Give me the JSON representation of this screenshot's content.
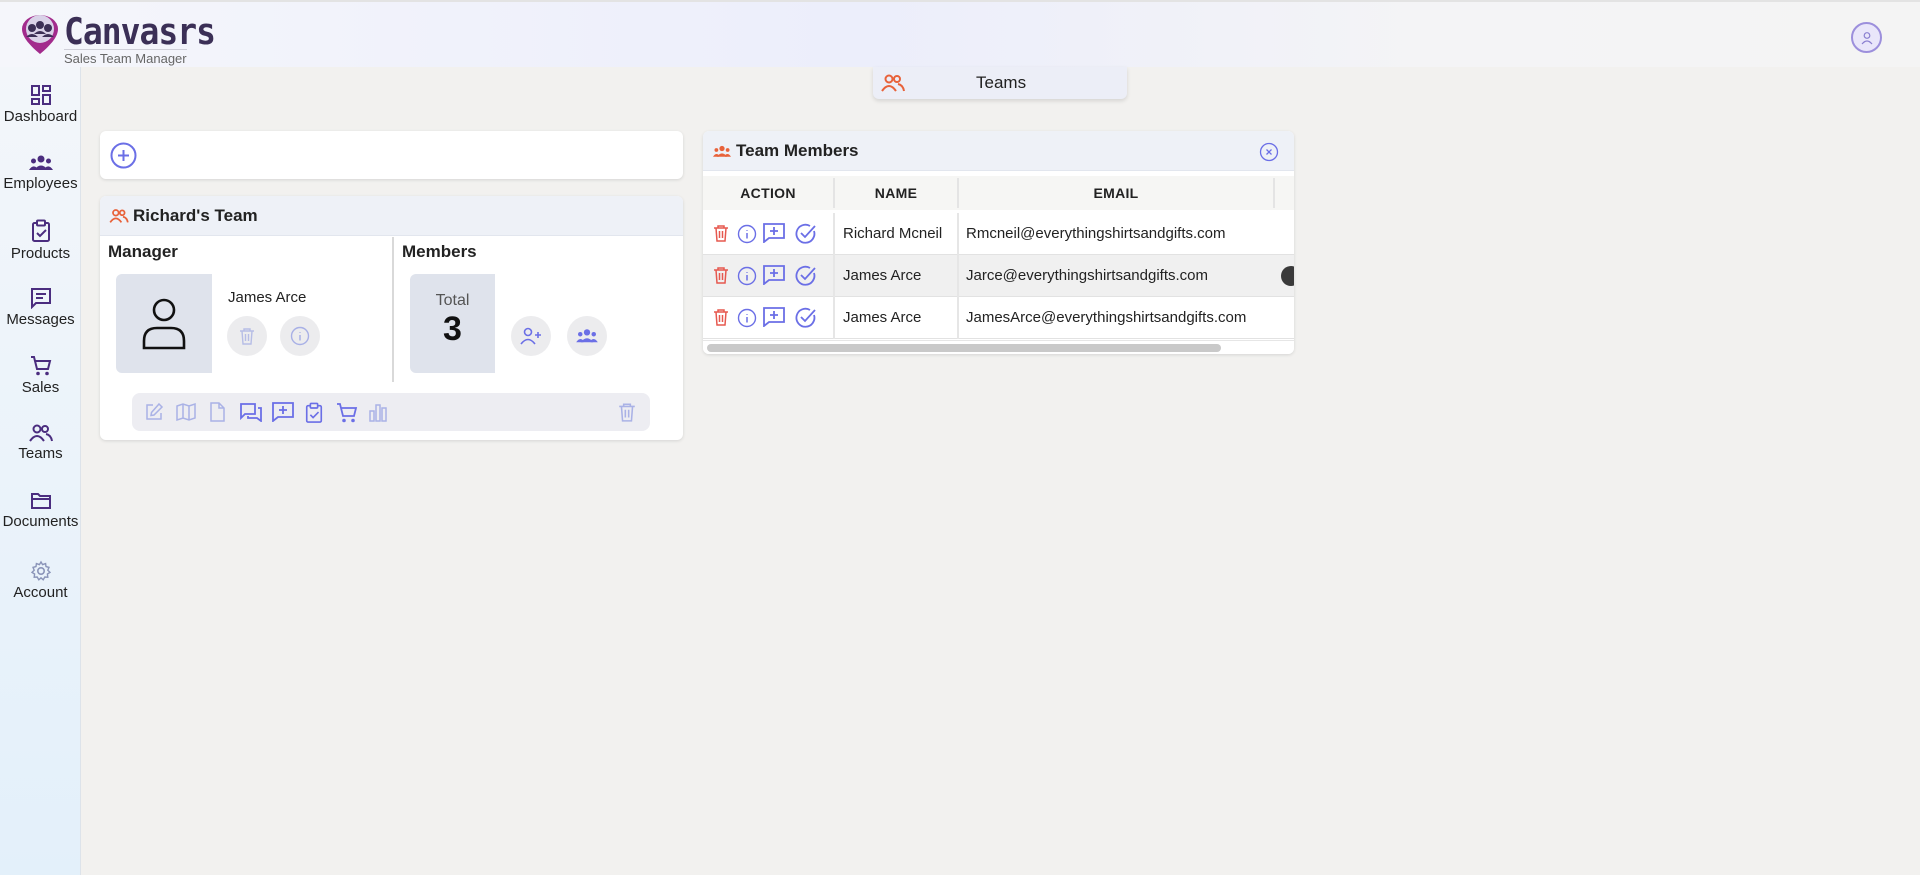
{
  "app": {
    "brand": "Canvasrs",
    "subtitle": "Sales Team Manager"
  },
  "colors": {
    "accent": "#6b6fe6",
    "nav_icon": "#4b2d7f",
    "orange_icon": "#e8623a",
    "delete_red": "#e6584f",
    "panel_header": "#eef1f7"
  },
  "sidebar": {
    "items": [
      {
        "label": "Dashboard",
        "icon": "dashboard-icon"
      },
      {
        "label": "Employees",
        "icon": "employees-icon"
      },
      {
        "label": "Products",
        "icon": "clipboard-check-icon"
      },
      {
        "label": "Messages",
        "icon": "message-icon"
      },
      {
        "label": "Sales",
        "icon": "cart-icon"
      },
      {
        "label": "Teams",
        "icon": "teams-icon"
      },
      {
        "label": "Documents",
        "icon": "folder-icon"
      },
      {
        "label": "Account",
        "icon": "gear-icon"
      }
    ]
  },
  "page_tab": {
    "label": "Teams",
    "icon": "teams-icon"
  },
  "team": {
    "title": "Richard's Team",
    "manager_title": "Manager",
    "manager_name": "James Arce",
    "members_title": "Members",
    "total_label": "Total",
    "total_value": "3"
  },
  "members_panel": {
    "title": "Team Members",
    "columns": [
      "ACTION",
      "NAME",
      "EMAIL"
    ],
    "rows": [
      {
        "name": "Richard Mcneil",
        "email": "Rmcneil@everythingshirtsandgifts.com"
      },
      {
        "name": "James Arce",
        "email": "Jarce@everythingshirtsandgifts.com"
      },
      {
        "name": "James Arce",
        "email": "JamesArce@everythingshirtsandgifts.com"
      }
    ]
  }
}
